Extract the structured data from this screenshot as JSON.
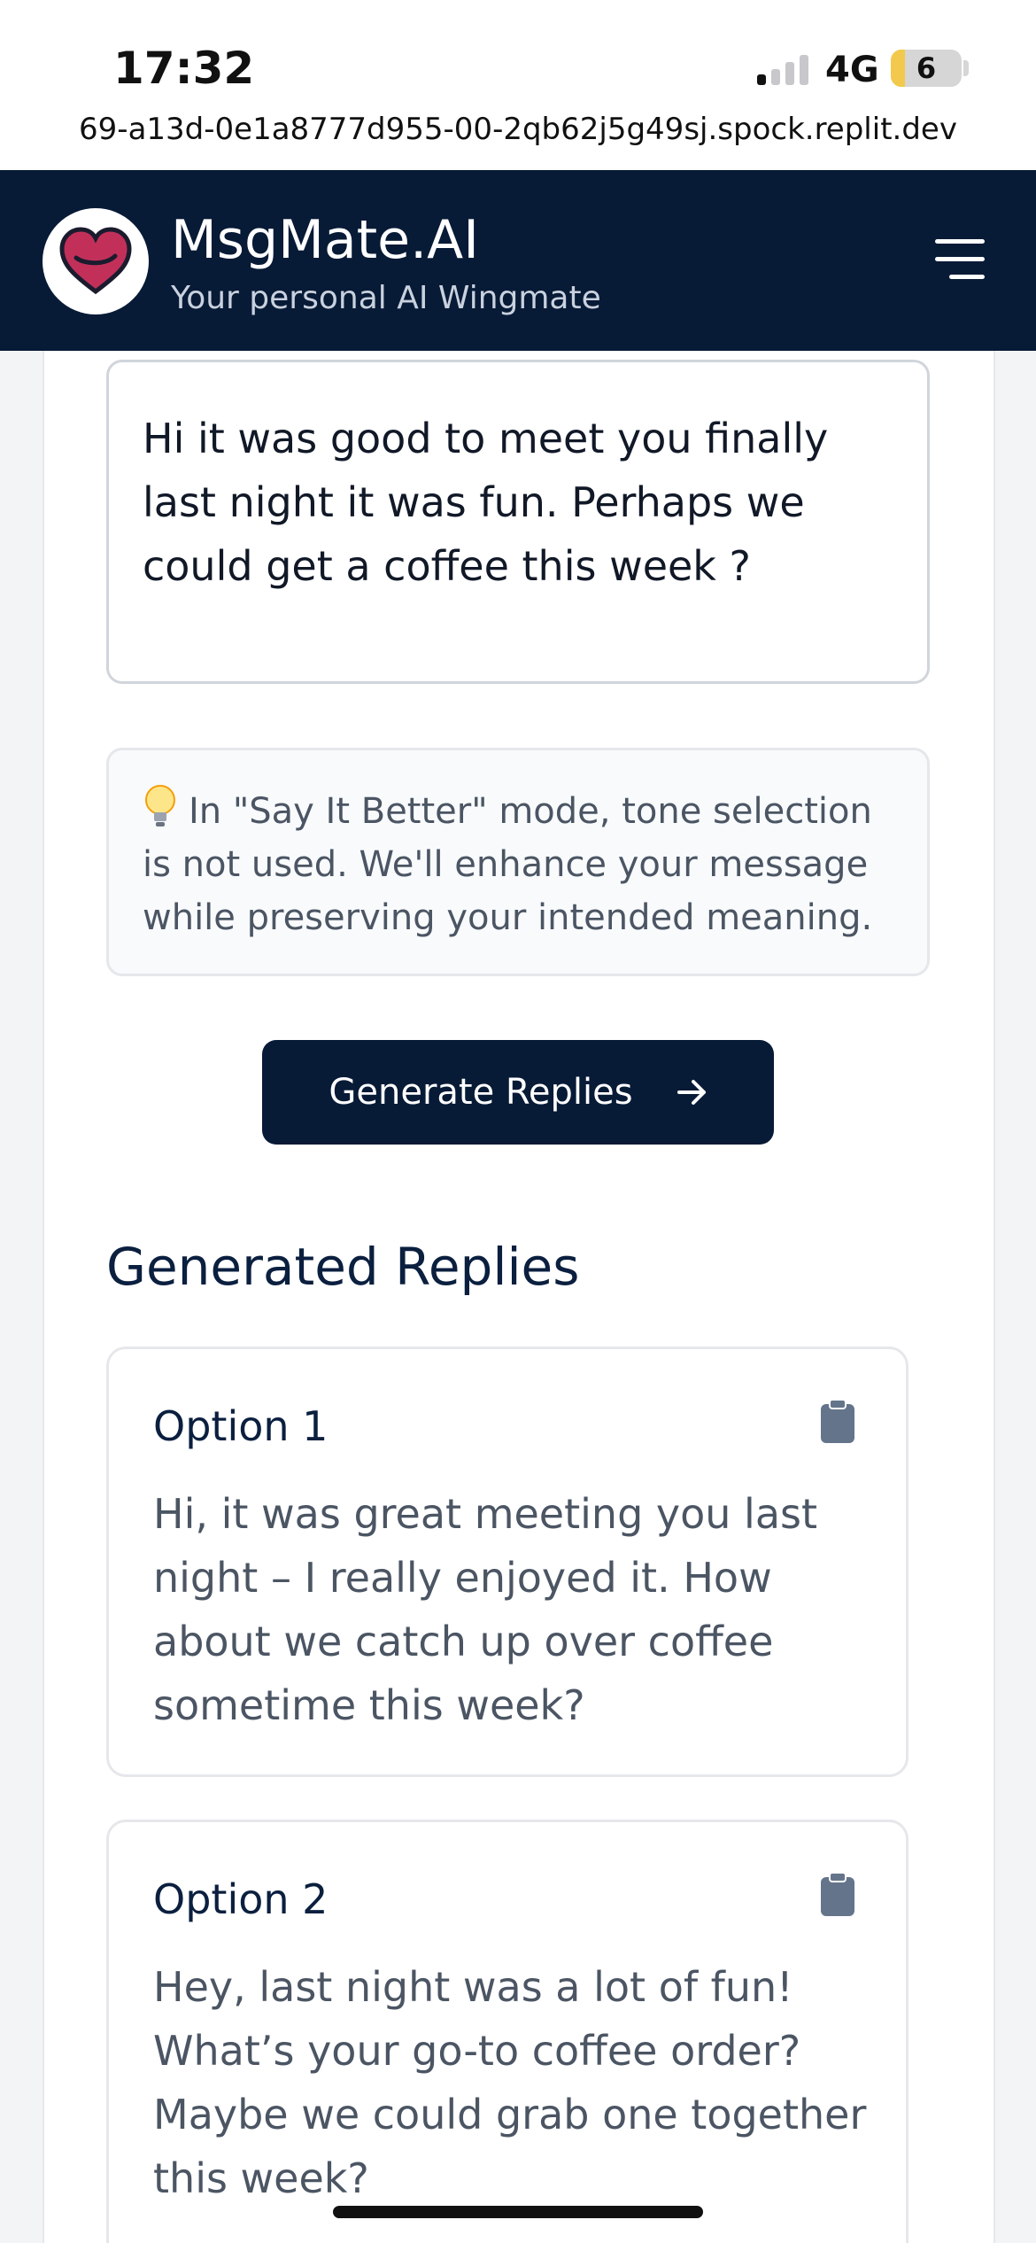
{
  "status_bar": {
    "time": "17:32",
    "network": "4G",
    "battery": "6"
  },
  "browser": {
    "url": "69-a13d-0e1a8777d955-00-2qb62j5g49sj.spock.replit.dev"
  },
  "header": {
    "title": "MsgMate.AI",
    "subtitle": "Your personal AI Wingmate",
    "accent": "#071a36",
    "logo_color": "#c2305a"
  },
  "input": {
    "message": "Hi it was good to meet you finally last night it was fun. Perhaps we could get a coffee this week ?"
  },
  "info": {
    "icon": "lightbulb-icon",
    "text": "In \"Say It Better\" mode, tone selection is not used. We'll enhance your message while preserving your intended meaning."
  },
  "actions": {
    "generate_label": "Generate Replies"
  },
  "replies": {
    "section_title": "Generated Replies",
    "items": [
      {
        "label": "Option 1",
        "text": "Hi, it was great meeting you last night – I really enjoyed it. How about we catch up over coffee sometime this week?"
      },
      {
        "label": "Option 2",
        "text": "Hey, last night was a lot of fun! What’s your go-to coffee order? Maybe we could grab one together this week?"
      }
    ]
  }
}
